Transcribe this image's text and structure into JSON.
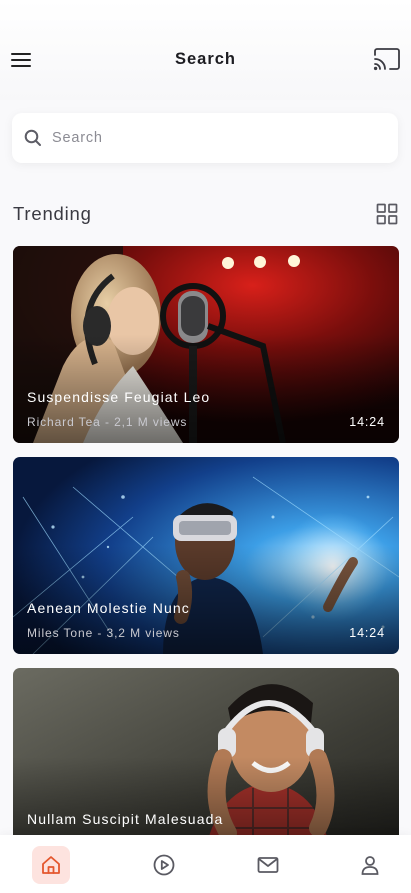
{
  "header": {
    "title": "Search",
    "menu_icon": "hamburger-menu-icon",
    "cast_icon": "cast-icon"
  },
  "search": {
    "placeholder": "Search",
    "value": "",
    "icon": "search-icon"
  },
  "trending": {
    "title": "Trending",
    "view_toggle_icon": "grid-view-icon",
    "videos": [
      {
        "title": "Suspendisse Feugiat Leo",
        "meta": "Richard Tea - 2,1 M views",
        "duration": "14:24",
        "thumbnail": "singer-at-microphone"
      },
      {
        "title": "Aenean Molestie Nunc",
        "meta": "Miles Tone - 3,2 M views",
        "duration": "14:24",
        "thumbnail": "person-in-vr-headset"
      },
      {
        "title": "Nullam Suscipit Malesuada",
        "meta": "",
        "duration": "",
        "thumbnail": "man-with-headphones"
      }
    ]
  },
  "bottom_nav": {
    "items": [
      {
        "name": "home",
        "icon": "home-icon",
        "active": true
      },
      {
        "name": "play",
        "icon": "play-circle-icon",
        "active": false
      },
      {
        "name": "messages",
        "icon": "mail-icon",
        "active": false
      },
      {
        "name": "profile",
        "icon": "user-icon",
        "active": false
      }
    ]
  },
  "colors": {
    "accent": "#e4572e",
    "active_nav_bg": "#fde3df",
    "background": "#f9f9fb",
    "text": "#1e1e24"
  }
}
